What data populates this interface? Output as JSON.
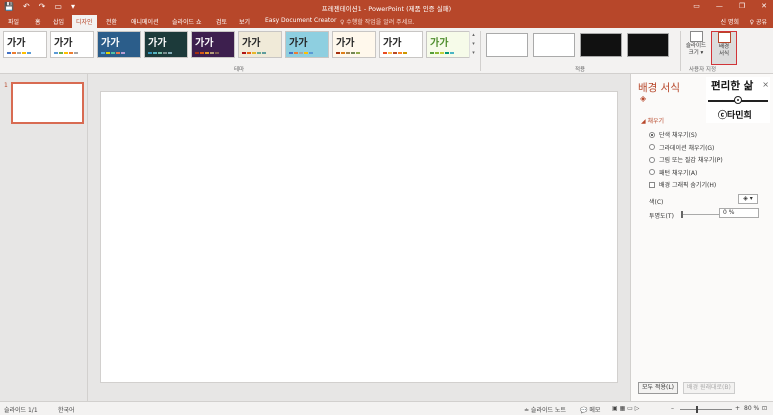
{
  "titlebar": {
    "title": "프레젠테이션1 - PowerPoint (제품 인증 실패)",
    "qat": [
      "💾",
      "↶",
      "↷",
      "▭",
      "▾"
    ],
    "win_buttons": [
      "▭",
      "—",
      "❐",
      "✕"
    ]
  },
  "tabs": {
    "items": [
      "파일",
      "홈",
      "삽입",
      "디자인",
      "전환",
      "애니메이션",
      "슬라이드 쇼",
      "검토",
      "보기",
      "Easy Document Creator"
    ],
    "tell_me": "♀ 수행할 작업을 알려 주세요.",
    "user": "신 명희",
    "share": "♀ 공유"
  },
  "ribbon": {
    "theme_glyph": "가가",
    "theme_group_label": "테마",
    "variant_group_label": "적용",
    "customize_group_label": "사용자 지정",
    "slide_size": "슬라이드\n크기 ▾",
    "background_format": "배경\n서식",
    "scroll_glyphs": [
      "▴",
      "▾",
      "▾"
    ]
  },
  "themes": [
    {
      "bg": "#ffffff",
      "fg": "#222222",
      "colors": [
        "#4472c4",
        "#ed7d31",
        "#a5a5a5",
        "#ffc000",
        "#5b9bd5"
      ]
    },
    {
      "bg": "#ffffff",
      "fg": "#222222",
      "colors": [
        "#5b9bd5",
        "#70ad47",
        "#ffc000",
        "#ed7d31",
        "#a5a5a5"
      ]
    },
    {
      "bg": "#2b5d8a",
      "fg": "#ffffff",
      "colors": [
        "#4ea6dc",
        "#e2d400",
        "#51c0a6",
        "#e8784a",
        "#b59dd3"
      ]
    },
    {
      "bg": "#1c3a3a",
      "fg": "#ffffff",
      "colors": [
        "#3494ba",
        "#58b6c0",
        "#75bda7",
        "#7a8c8e",
        "#84acb6"
      ]
    },
    {
      "bg": "#3d1f4e",
      "fg": "#ffffff",
      "colors": [
        "#a5300f",
        "#d55816",
        "#e19825",
        "#b19c7d",
        "#7f5f52"
      ]
    },
    {
      "bg": "#f0ead8",
      "fg": "#222222",
      "colors": [
        "#b01513",
        "#ea6312",
        "#e6b729",
        "#6aac90",
        "#5f9c9d"
      ]
    },
    {
      "bg": "#8ecfe0",
      "fg": "#222222",
      "colors": [
        "#4472c4",
        "#ed7d31",
        "#a5a5a5",
        "#ffc000",
        "#5b9bd5"
      ]
    },
    {
      "bg": "#fff8ec",
      "fg": "#222222",
      "colors": [
        "#a53010",
        "#de7e18",
        "#9f8351",
        "#728653",
        "#92aa4c"
      ]
    },
    {
      "bg": "#ffffff",
      "fg": "#222222",
      "colors": [
        "#e84c22",
        "#ffbd47",
        "#b64926",
        "#ff8427",
        "#cc9900"
      ]
    },
    {
      "bg": "#f6fbe9",
      "fg": "#4c8c2b",
      "colors": [
        "#549e39",
        "#8ab833",
        "#c0cf3a",
        "#029676",
        "#4ab5c4"
      ]
    }
  ],
  "variants": [
    {
      "bg": "#ffffff"
    },
    {
      "bg": "#ffffff"
    },
    {
      "bg": "#111111"
    },
    {
      "bg": "#111111"
    }
  ],
  "slides_pane": {
    "number": "1"
  },
  "format_panel": {
    "title": "배경 서식",
    "close": "×",
    "fill_icon": "◈",
    "watermark_line1": "편리한 삶",
    "watermark_line2": "ⓒ타민희",
    "fill_section": "◢ 채우기",
    "options": [
      {
        "label": "단색 채우기(S)",
        "type": "radio",
        "checked": true
      },
      {
        "label": "그라데이션 채우기(G)",
        "type": "radio",
        "checked": false
      },
      {
        "label": "그림 또는 질감 채우기(P)",
        "type": "radio",
        "checked": false
      },
      {
        "label": "패턴 채우기(A)",
        "type": "radio",
        "checked": false
      },
      {
        "label": "배경 그래픽 숨기기(H)",
        "type": "checkbox",
        "checked": false
      }
    ],
    "color_label": "색(C)",
    "color_button": "◈ ▾",
    "transparency_label": "투명도(T)",
    "transparency_value": "0 %",
    "transparency_percent": 0,
    "apply_all": "모두 적용(L)",
    "reset_background": "배경 원래대로(B)"
  },
  "statusbar": {
    "slide_count": "슬라이드 1/1",
    "language": "한국어",
    "notes": "≐ 슬라이드 노트",
    "comments": "💬 메모",
    "view_icons": "▣ ▦ ▭ ▷",
    "zoom_minus": "–",
    "zoom_plus": "+",
    "zoom": "80 %",
    "fit": "⊡",
    "zoom_percent": 80
  }
}
